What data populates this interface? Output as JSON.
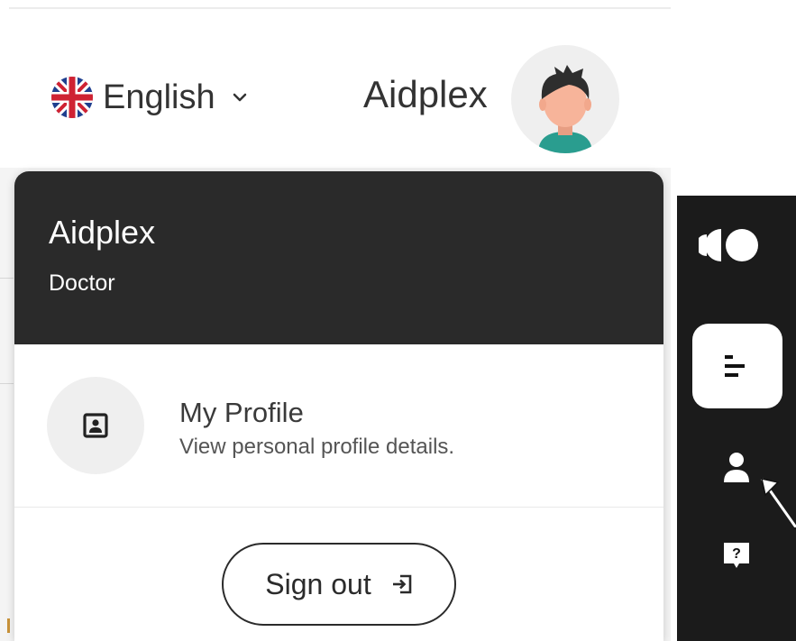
{
  "header": {
    "language": {
      "label": "English",
      "flag_icon": "uk-flag-icon",
      "chevron_icon": "chevron-down-icon"
    },
    "user_name": "Aidplex",
    "avatar_icon": "user-avatar"
  },
  "dropdown": {
    "name": "Aidplex",
    "role": "Doctor",
    "item": {
      "icon": "profile-badge-icon",
      "title": "My Profile",
      "subtitle": "View personal profile details."
    },
    "signout": {
      "label": "Sign out",
      "icon": "sign-out-icon"
    }
  },
  "sidebar": {
    "logo_icon": "brand-logo-icon",
    "items": [
      {
        "name": "menu",
        "icon": "menu-icon",
        "active": true
      },
      {
        "name": "profile",
        "icon": "user-icon",
        "active": false
      },
      {
        "name": "help",
        "icon": "help-icon",
        "active": false
      }
    ]
  },
  "colors": {
    "sidebar_bg": "#1b1b1b",
    "dropdown_header_bg": "#2a2a2a",
    "avatar_skin": "#f7b49a",
    "avatar_shirt": "#2a9d8f",
    "avatar_hair": "#2e2e2e",
    "flag_blue": "#1f3f8f",
    "flag_red": "#cf2233"
  }
}
